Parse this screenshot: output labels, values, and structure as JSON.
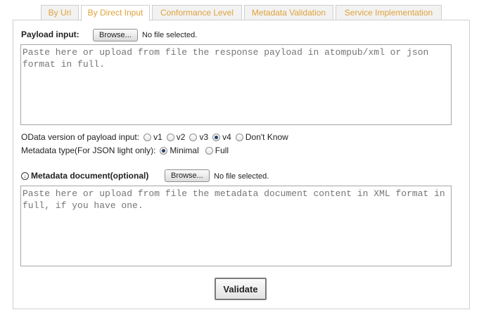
{
  "tabs": [
    {
      "label": "By Uri"
    },
    {
      "label": "By Direct Input"
    },
    {
      "label": "Conformance Level"
    },
    {
      "label": "Metadata Validation"
    },
    {
      "label": "Service Implementation"
    }
  ],
  "active_tab": "By Direct Input",
  "payload": {
    "label": "Payload input:",
    "browse_label": "Browse...",
    "file_status": "No file selected.",
    "placeholder": "Paste here or upload from file the response payload in atompub/xml or json format in full."
  },
  "odata_version": {
    "label": "OData version of payload input:",
    "options": [
      "v1",
      "v2",
      "v3",
      "v4",
      "Don't Know"
    ],
    "selected": "v4"
  },
  "metadata_type": {
    "label": "Metadata type(For JSON light only):",
    "options": [
      "Minimal",
      "Full"
    ],
    "selected": "Minimal"
  },
  "metadata_doc": {
    "label": "Metadata document(optional)",
    "browse_label": "Browse...",
    "file_status": "No file selected.",
    "placeholder": "Paste here or upload from file the metadata document content in XML format in full, if you have one."
  },
  "validate_label": "Validate",
  "colors": {
    "tab_text": "#e0a23a",
    "border": "#cfcfcf"
  }
}
